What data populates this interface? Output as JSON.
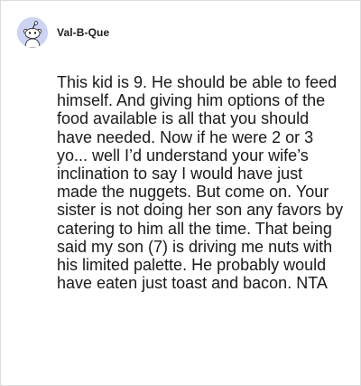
{
  "comment": {
    "username": "Val-B-Que",
    "avatar_icon": "reddit-snoo-avatar-icon",
    "avatar_color": "#cdd3f2",
    "body": "This kid is 9. He should be able to feed himself. And giving him options of the food available is all that you should have needed. Now if he were 2 or 3 yo... well I’d understand your wife’s inclination to say I would have just made the nuggets. But come on. Your sister is not doing her son any favors by catering to him all the time. That being said my son (7) is driving me nuts with his limited palette. He probably would have eaten just toast and bacon. NTA"
  }
}
